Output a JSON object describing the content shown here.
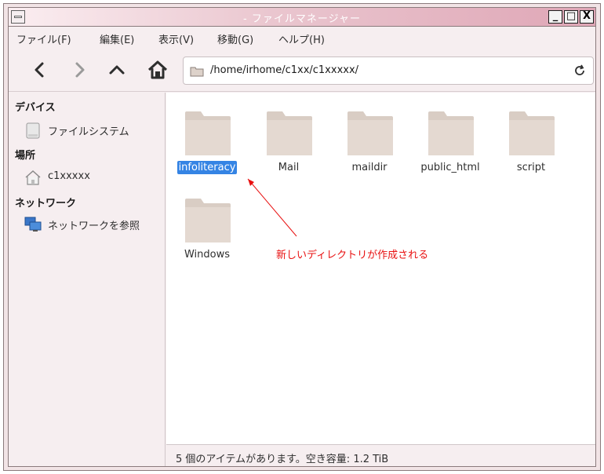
{
  "window": {
    "title": "- ファイルマネージャー",
    "buttons": {
      "minimize": "_",
      "maximize": "□",
      "close": "X"
    }
  },
  "menubar": {
    "items": [
      "ファイル(F)",
      "編集(E)",
      "表示(V)",
      "移動(G)",
      "ヘルプ(H)"
    ]
  },
  "toolbar": {
    "path": "/home/irhome/c1xx/c1xxxxx/",
    "icons": [
      "back-icon",
      "forward-icon",
      "up-icon",
      "home-icon",
      "reload-icon"
    ]
  },
  "sidebar": {
    "devices_heading": "デバイス",
    "filesystem_label": "ファイルシステム",
    "places_heading": "場所",
    "home_label": "c1xxxxx",
    "network_heading": "ネットワーク",
    "browse_network_label": "ネットワークを参照"
  },
  "files": [
    {
      "name": "infoliteracy",
      "selected": true
    },
    {
      "name": "Mail",
      "selected": false
    },
    {
      "name": "maildir",
      "selected": false
    },
    {
      "name": "public_html",
      "selected": false
    },
    {
      "name": "script",
      "selected": false
    },
    {
      "name": "Windows",
      "selected": false
    }
  ],
  "annotation": {
    "text": "新しいディレクトリが作成される",
    "color": "#e81010"
  },
  "statusbar": {
    "text": "5 個のアイテムがあります。空き容量: 1.2 TiB"
  },
  "colors": {
    "selection": "#3584e4",
    "folder": "#ddd2ca",
    "titlebar_end": "#dfa6b6"
  }
}
